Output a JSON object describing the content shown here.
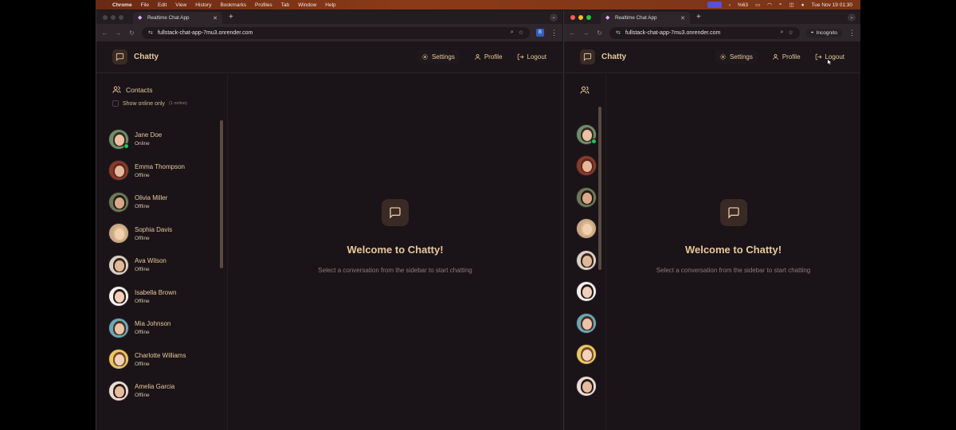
{
  "menubar": {
    "app": "Chrome",
    "items": [
      "File",
      "Edit",
      "View",
      "History",
      "Bookmarks",
      "Profiles",
      "Tab",
      "Window",
      "Help"
    ],
    "battery": "%63",
    "datetime": "Tue Nov 19  01:30"
  },
  "browser": {
    "tab_title": "Realtime Chat App",
    "url": "fullstack-chat-app-7mu3.onrender.com",
    "incognito_label": "Incognito",
    "ext_badge": "B"
  },
  "app": {
    "name": "Chatty",
    "nav": {
      "settings": "Settings",
      "profile": "Profile",
      "logout": "Logout"
    },
    "sidebar": {
      "title": "Contacts",
      "filter_label": "Show online only",
      "online_count": "(1 online)"
    },
    "contacts": [
      {
        "name": "Jane Doe",
        "status": "Online",
        "online": true,
        "bg": "#6b8f6a",
        "skin": "#e9c2a4",
        "hair": "#3a2a20"
      },
      {
        "name": "Emma Thompson",
        "status": "Offline",
        "online": false,
        "bg": "#8a3a2a",
        "skin": "#e6b89a",
        "hair": "#5a2a1a"
      },
      {
        "name": "Olivia Miller",
        "status": "Offline",
        "online": false,
        "bg": "#6a7a5a",
        "skin": "#d9a98a",
        "hair": "#2a1a14"
      },
      {
        "name": "Sophia Davis",
        "status": "Offline",
        "online": false,
        "bg": "#c9a88a",
        "skin": "#f0d0b0",
        "hair": "#d8b884"
      },
      {
        "name": "Ava Wilson",
        "status": "Offline",
        "online": false,
        "bg": "#d8d0c8",
        "skin": "#e0b89a",
        "hair": "#3a2418"
      },
      {
        "name": "Isabella Brown",
        "status": "Offline",
        "online": false,
        "bg": "#f4f0ee",
        "skin": "#f0d0bc",
        "hair": "#2a1a14"
      },
      {
        "name": "Mia Johnson",
        "status": "Offline",
        "online": false,
        "bg": "#6aa8b8",
        "skin": "#e8c4a8",
        "hair": "#4a3020"
      },
      {
        "name": "Charlotte Williams",
        "status": "Offline",
        "online": false,
        "bg": "#e8c860",
        "skin": "#f2d2b8",
        "hair": "#7a4a2a"
      },
      {
        "name": "Amelia Garcia",
        "status": "Offline",
        "online": false,
        "bg": "#e8dcd4",
        "skin": "#e6bc9c",
        "hair": "#2a1a14"
      }
    ],
    "welcome": {
      "title": "Welcome to Chatty!",
      "subtitle": "Select a conversation from the sidebar to start chatting"
    },
    "colors": {
      "accent": "#e8c89c",
      "background": "#1a1418",
      "online": "#22c55e"
    }
  }
}
